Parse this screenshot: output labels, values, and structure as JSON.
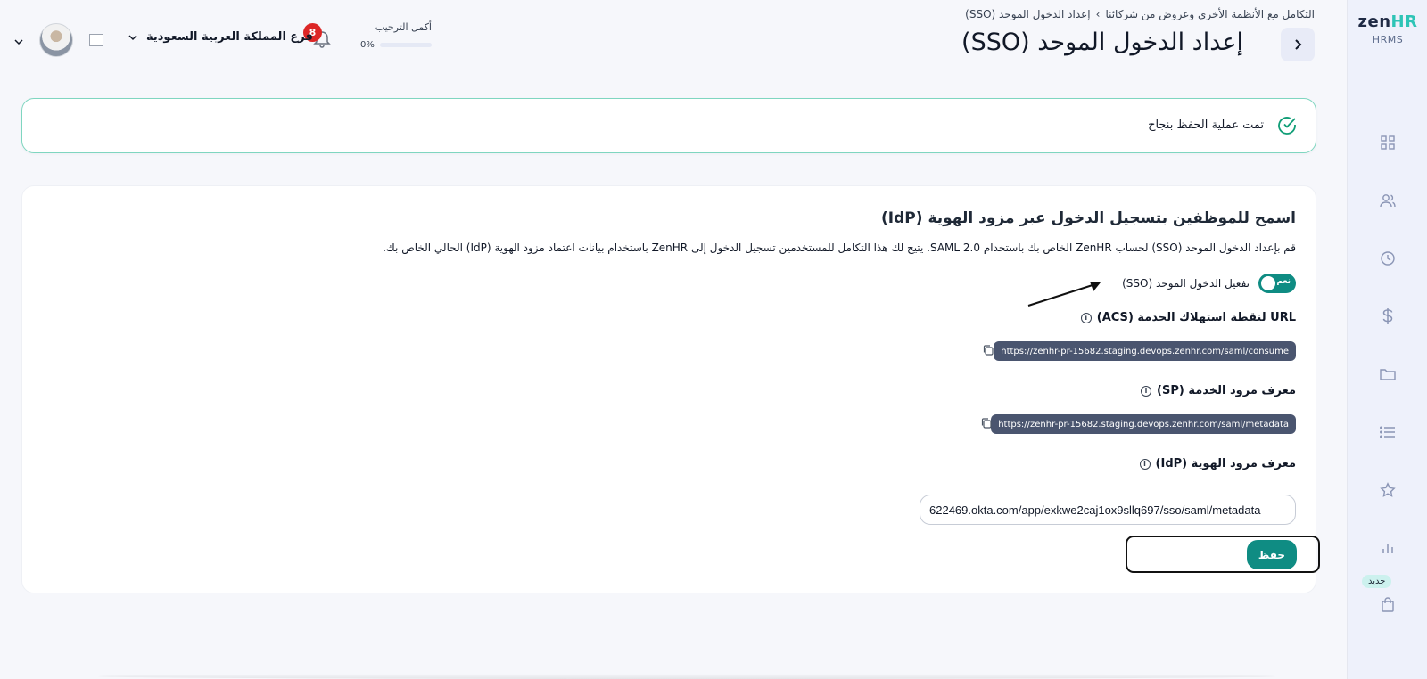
{
  "brand": {
    "logo_prefix": "zen",
    "logo_suffix": "HR",
    "subtitle": "HRMS",
    "accent_color": "#0f8c83",
    "logo_accent_color": "#2ec4b6"
  },
  "sidebar": {
    "items": [
      {
        "icon": "grid-icon"
      },
      {
        "icon": "users-icon"
      },
      {
        "icon": "clock-icon"
      },
      {
        "icon": "dollar-icon"
      },
      {
        "icon": "folder-icon"
      },
      {
        "icon": "list-icon"
      },
      {
        "icon": "star-icon"
      },
      {
        "icon": "bar-chart-icon"
      },
      {
        "icon": "shopping-bag-icon",
        "badge": "جديد"
      }
    ]
  },
  "header": {
    "breadcrumb": {
      "parent": "التكامل مع الأنظمة الأخرى وعروض من شركائنا",
      "separator": "›",
      "current": "إعداد الدخول الموحد (SSO)"
    },
    "title": "إعداد الدخول الموحد (SSO)",
    "onboarding": {
      "label": "أكمل الترحيب",
      "percent_label": "0%",
      "progress": 0
    },
    "notifications_count": "8",
    "branch": "فرع المملكة العربية السعودية"
  },
  "alert": {
    "message": "تمت عملية الحفظ بنجاح",
    "border_color": "#7fd6c0"
  },
  "card": {
    "title": "اسمح للموظفين بتسجيل الدخول عبر مزود الهوية (IdP)",
    "description": "قم بإعداد الدخول الموحد (SSO) لحساب ZenHR الخاص بك باستخدام SAML 2.0. يتيح لك هذا التكامل للمستخدمين تسجيل الدخول إلى ZenHR باستخدام بيانات اعتماد مزود الهوية (IdP) الحالي الخاص بك.",
    "toggle": {
      "label": "تفعيل الدخول الموحد (SSO)",
      "state_text": "نعم",
      "enabled": true
    },
    "acs": {
      "label": "URL لنقطة استهلاك الخدمة (ACS)",
      "value": "https://zenhr-pr-15682.staging.devops.zenhr.com/saml/consume"
    },
    "sp": {
      "label": "معرف مزود الخدمة (SP)",
      "value": "https://zenhr-pr-15682.staging.devops.zenhr.com/saml/metadata"
    },
    "idp": {
      "label": "معرف مزود الهوية (IdP)",
      "value": "622469.okta.com/app/exkwe2caj1ox9sllq697/sso/saml/metadata",
      "placeholder": ""
    },
    "save_label": "حفظ"
  }
}
